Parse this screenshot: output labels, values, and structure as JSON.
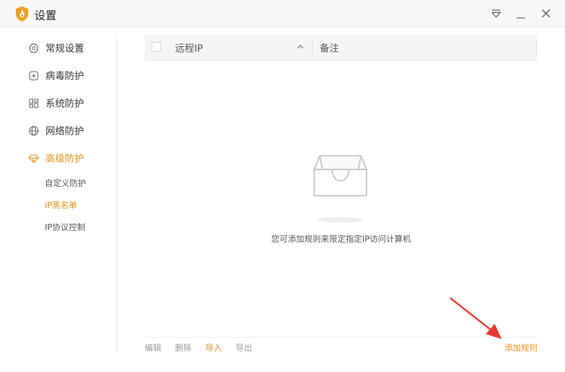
{
  "window": {
    "title": "设置"
  },
  "titlebar": {
    "menu_icon": "dropdown-menu-icon",
    "min_icon": "minimize-icon",
    "close_icon": "close-icon"
  },
  "sidebar": {
    "items": [
      {
        "label": "常规设置",
        "icon": "gear-icon"
      },
      {
        "label": "病毒防护",
        "icon": "plus-square-icon"
      },
      {
        "label": "系统防护",
        "icon": "grid-icon"
      },
      {
        "label": "网络防护",
        "icon": "globe-icon"
      },
      {
        "label": "高级防护",
        "icon": "diamond-icon",
        "active": true
      }
    ],
    "sub_items": [
      {
        "label": "自定义防护"
      },
      {
        "label": "IP黑名单",
        "active": true
      },
      {
        "label": "IP协议控制"
      }
    ]
  },
  "table": {
    "columns": [
      "远程IP",
      "备注"
    ],
    "sort_icon": "chevron-up-icon",
    "rows": []
  },
  "empty_state": {
    "icon": "empty-inbox-icon",
    "text": "您可添加规则来限定指定IP访问计算机"
  },
  "footer": {
    "actions": [
      "编辑",
      "删除",
      "导入",
      "导出"
    ],
    "add_rule": "添加规则"
  },
  "colors": {
    "accent": "#e58e1a",
    "arrow": "#e53935"
  }
}
